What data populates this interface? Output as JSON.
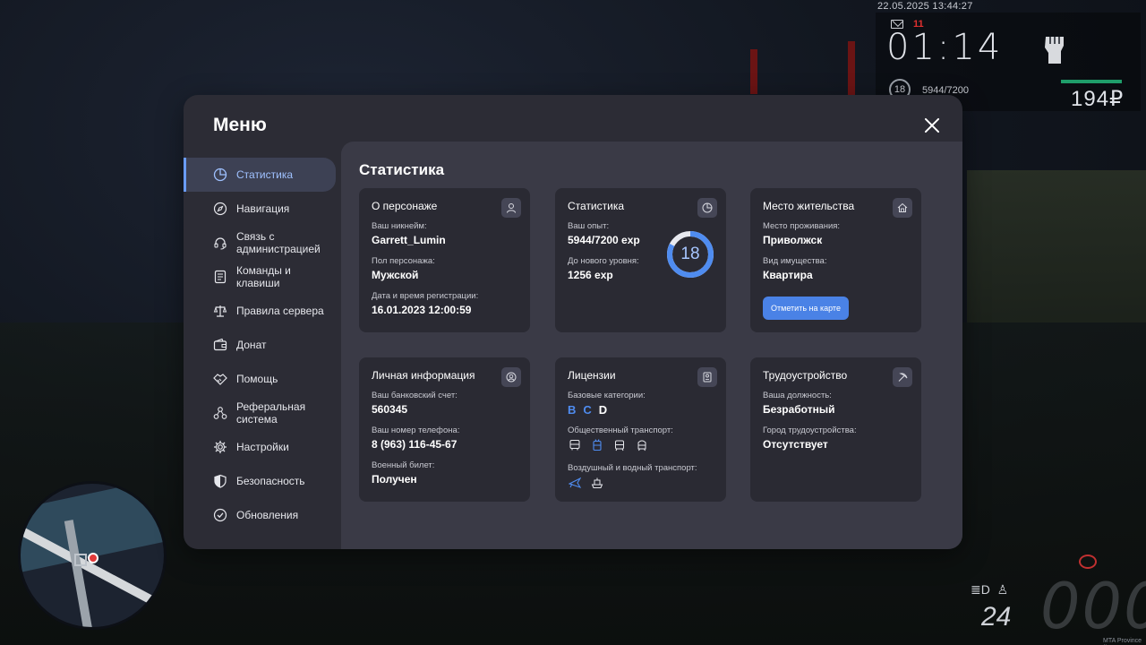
{
  "hud": {
    "datetime": "22.05.2025 13:44:27",
    "mail_count": "11",
    "time": "01:14",
    "level": "18",
    "exp": "5944/7200",
    "money": "194₽",
    "fuel": "24",
    "server": "MTA Province #"
  },
  "menu": {
    "title": "Меню",
    "sidebar": [
      {
        "label": "Статистика",
        "icon": "pie-chart-icon",
        "active": true
      },
      {
        "label": "Навигация",
        "icon": "compass-icon"
      },
      {
        "label": "Связь с администрацией",
        "icon": "headset-icon"
      },
      {
        "label": "Команды и клавиши",
        "icon": "keyboard-icon"
      },
      {
        "label": "Правила сервера",
        "icon": "scales-icon"
      },
      {
        "label": "Донат",
        "icon": "wallet-icon"
      },
      {
        "label": "Помощь",
        "icon": "handshake-icon"
      },
      {
        "label": "Реферальная система",
        "icon": "network-icon"
      },
      {
        "label": "Настройки",
        "icon": "gear-icon"
      },
      {
        "label": "Безопасность",
        "icon": "shield-icon"
      },
      {
        "label": "Обновления",
        "icon": "check-circle-icon"
      }
    ]
  },
  "content": {
    "title": "Статистика",
    "character": {
      "title": "О персонаже",
      "nickname_label": "Ваш никнейм:",
      "nickname": "Garrett_Lumin",
      "gender_label": "Пол персонажа:",
      "gender": "Мужской",
      "reg_label": "Дата и время регистрации:",
      "reg_value": "16.01.2023 12:00:59"
    },
    "stats": {
      "title": "Статистика",
      "exp_label": "Ваш опыт:",
      "exp_value": "5944/7200 exp",
      "next_label": "До нового уровня:",
      "next_value": "1256 exp",
      "level": "18",
      "level_progress": 0.8256
    },
    "residence": {
      "title": "Место жительства",
      "place_label": "Место проживания:",
      "place_value": "Приволжск",
      "property_label": "Вид имущества:",
      "property_value": "Квартира",
      "button": "Отметить на карте"
    },
    "personal": {
      "title": "Личная информация",
      "bank_label": "Ваш банковский счет:",
      "bank_value": "560345",
      "phone_label": "Ваш номер телефона:",
      "phone_value": "8 (963) 116-45-67",
      "military_label": "Военный билет:",
      "military_value": "Получен"
    },
    "licenses": {
      "title": "Лицензии",
      "base_label": "Базовые категории:",
      "categories": [
        {
          "name": "B",
          "color": "#4f8cf0"
        },
        {
          "name": "C",
          "color": "#4f8cf0"
        },
        {
          "name": "D",
          "color": "#ffffff"
        }
      ],
      "public_label": "Общественный транспорт:",
      "air_label": "Воздушный и водный транспорт:"
    },
    "employment": {
      "title": "Трудоустройство",
      "position_label": "Ваша должность:",
      "position_value": "Безработный",
      "city_label": "Город трудоустройства:",
      "city_value": "Отсутствует"
    }
  },
  "colors": {
    "accent": "#4a82e6",
    "active_text": "#9fc1ff",
    "card_bg": "#2a2a33",
    "window_bg": "#2c2c35",
    "content_bg": "#3a3a46"
  }
}
